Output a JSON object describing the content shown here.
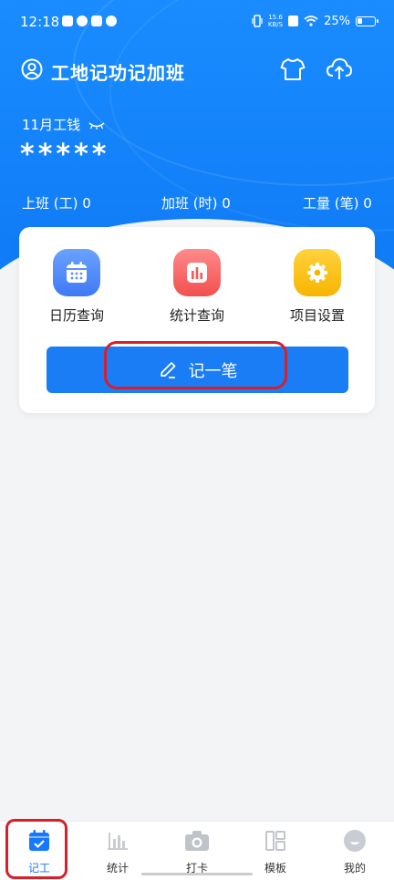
{
  "status_bar": {
    "time": "12:18",
    "net_speed": "15.6",
    "net_unit": "KB/S",
    "battery": "25%"
  },
  "header": {
    "title": "工地记功记加班",
    "icons": [
      "user-icon",
      "shirt-icon",
      "cloud-upload-icon"
    ]
  },
  "summary": {
    "wage_label": "11月工钱",
    "wage_value": "*****",
    "stats": [
      {
        "label": "上班 (工) 0"
      },
      {
        "label": "加班 (时) 0"
      },
      {
        "label": "工量 (笔) 0"
      }
    ]
  },
  "actions": [
    {
      "label": "日历查询",
      "icon": "calendar-icon",
      "color": "#4f86f7"
    },
    {
      "label": "统计查询",
      "icon": "bar-chart-icon",
      "color": "#f25a5a"
    },
    {
      "label": "项目设置",
      "icon": "gear-icon",
      "color": "#f9bc0f"
    }
  ],
  "record_button": {
    "label": "记一笔"
  },
  "tabs": [
    {
      "label": "记工",
      "icon": "calendar-check-icon",
      "active": true
    },
    {
      "label": "统计",
      "icon": "bar-chart-icon"
    },
    {
      "label": "打卡",
      "icon": "camera-icon"
    },
    {
      "label": "模板",
      "icon": "template-icon"
    },
    {
      "label": "我的",
      "icon": "profile-icon"
    }
  ],
  "colors": {
    "brand": "#1a7df5",
    "highlight": "#d6202a",
    "background": "#f3f4f6"
  }
}
